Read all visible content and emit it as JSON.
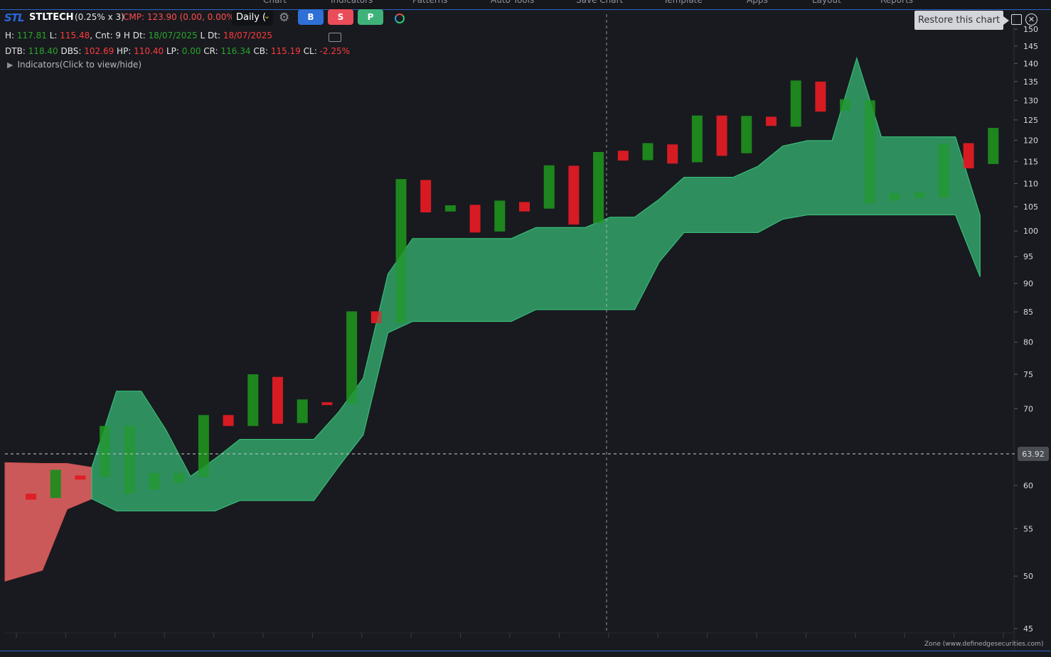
{
  "menu": {
    "items": [
      "Chart",
      "Indicators",
      "Patterns",
      "Auto Tools",
      "Save Chart",
      "Template",
      "Apps",
      "Layout",
      "Reports"
    ]
  },
  "toolbar": {
    "logo": "STL",
    "symbol": "STLTECH",
    "box_info": "(0.25% x 3)",
    "cmp": "CMP: 123.90 (0.00, 0.00%)",
    "timeframe": "Daily (",
    "buy_label": "B",
    "sell_label": "S",
    "p_label": "P"
  },
  "stats": {
    "row1": [
      {
        "label": "H: ",
        "value": "117.81",
        "color": "g"
      },
      {
        "label": " L: ",
        "value": "115.48",
        "color": "r"
      },
      {
        "label": ", Cnt: 9 H Dt: ",
        "value": "18/07/2025",
        "color": "g"
      },
      {
        "label": " L Dt: ",
        "value": "18/07/2025",
        "color": "r"
      }
    ],
    "row2": [
      {
        "label": "DTB: ",
        "value": "118.40",
        "color": "g"
      },
      {
        "label": " DBS: ",
        "value": "102.69",
        "color": "r"
      },
      {
        "label": " HP: ",
        "value": "110.40",
        "color": "r"
      },
      {
        "label": " LP: ",
        "value": "0.00",
        "color": "g"
      },
      {
        "label": " CR: ",
        "value": "116.34",
        "color": "g"
      },
      {
        "label": " CB: ",
        "value": "115.19",
        "color": "r"
      },
      {
        "label": " CL: ",
        "value": "-2.25%",
        "color": "r"
      }
    ]
  },
  "indicators_label": "Indicators(Click to view/hide)",
  "tooltip": "Restore this chart",
  "credit": "Zone (www.definedgesecurities.com)",
  "crosshair_price": "63.92",
  "colors": {
    "up": "#1e8c1e",
    "down": "#e01b24",
    "cloud_green": "#34a86e",
    "cloud_red": "#e06060"
  },
  "chart_data": {
    "type": "candlestick",
    "scale": "log",
    "ylim": [
      45,
      150
    ],
    "yticks": [
      45,
      50,
      55,
      60,
      65,
      70,
      75,
      80,
      85,
      90,
      95,
      100,
      105,
      110,
      115,
      120,
      125,
      130,
      135,
      140,
      145,
      150
    ],
    "crosshair_y": 63.92,
    "bars": [
      {
        "dir": "down",
        "open": 59.0,
        "close": 58.3
      },
      {
        "dir": "up",
        "open": 58.5,
        "close": 61.9
      },
      {
        "dir": "down",
        "open": 61.2,
        "close": 60.7
      },
      {
        "dir": "up",
        "open": 61.0,
        "close": 67.6
      },
      {
        "dir": "up",
        "open": 59.0,
        "close": 67.6
      },
      {
        "dir": "up",
        "open": 59.5,
        "close": 61.5
      },
      {
        "dir": "up",
        "open": 60.3,
        "close": 61.5
      },
      {
        "dir": "up",
        "open": 61.0,
        "close": 69.1
      },
      {
        "dir": "down",
        "open": 69.1,
        "close": 67.6
      },
      {
        "dir": "up",
        "open": 67.6,
        "close": 75.0
      },
      {
        "dir": "down",
        "open": 74.6,
        "close": 67.9
      },
      {
        "dir": "up",
        "open": 68.0,
        "close": 71.3
      },
      {
        "dir": "down",
        "open": 70.9,
        "close": 70.5
      },
      {
        "dir": "up",
        "open": 70.7,
        "close": 85.1
      },
      {
        "dir": "down",
        "open": 85.1,
        "close": 83.1
      },
      {
        "dir": "up",
        "open": 83.1,
        "close": 111.0
      },
      {
        "dir": "down",
        "open": 110.8,
        "close": 103.8
      },
      {
        "dir": "up",
        "open": 104.0,
        "close": 105.3
      },
      {
        "dir": "down",
        "open": 105.4,
        "close": 99.7
      },
      {
        "dir": "up",
        "open": 99.9,
        "close": 106.3
      },
      {
        "dir": "down",
        "open": 106.0,
        "close": 104.0
      },
      {
        "dir": "up",
        "open": 104.6,
        "close": 114.1
      },
      {
        "dir": "down",
        "open": 114.0,
        "close": 101.3
      },
      {
        "dir": "up",
        "open": 101.6,
        "close": 117.2
      },
      {
        "dir": "down",
        "open": 117.5,
        "close": 115.2
      },
      {
        "dir": "up",
        "open": 115.3,
        "close": 119.3
      },
      {
        "dir": "down",
        "open": 119.0,
        "close": 114.5
      },
      {
        "dir": "up",
        "open": 114.8,
        "close": 126.1
      },
      {
        "dir": "down",
        "open": 126.1,
        "close": 116.3
      },
      {
        "dir": "up",
        "open": 116.9,
        "close": 126.0
      },
      {
        "dir": "down",
        "open": 125.8,
        "close": 123.5
      },
      {
        "dir": "up",
        "open": 123.3,
        "close": 135.3
      },
      {
        "dir": "down",
        "open": 135.0,
        "close": 127.1
      },
      {
        "dir": "up",
        "open": 127.3,
        "close": 130.3
      },
      {
        "dir": "up",
        "open": 105.7,
        "close": 130.0
      },
      {
        "dir": "up",
        "open": 106.3,
        "close": 107.9
      },
      {
        "dir": "up",
        "open": 106.8,
        "close": 108.1
      },
      {
        "dir": "up",
        "open": 106.9,
        "close": 119.2
      },
      {
        "dir": "down",
        "open": 119.3,
        "close": 113.4
      },
      {
        "dir": "up",
        "open": 114.4,
        "close": 123.0
      }
    ],
    "cloud_upper": [
      62.8,
      62.7,
      62.7,
      62.2,
      72.5,
      72.5,
      67.1,
      61.1,
      63.3,
      65.8,
      65.8,
      65.8,
      65.8,
      69.5,
      74.4,
      91.7,
      98.5,
      98.5,
      98.5,
      98.5,
      98.5,
      100.7,
      100.7,
      100.7,
      102.8,
      102.8,
      106.6,
      111.4,
      111.4,
      111.4,
      113.9,
      118.6,
      119.9,
      119.9,
      141.5,
      120.8,
      120.8,
      120.8,
      120.8,
      103.2
    ],
    "cloud_lower": [
      49.5,
      50.6,
      57.2,
      58.4,
      57.0,
      57.0,
      57.0,
      57.0,
      57.0,
      58.2,
      58.2,
      58.2,
      58.2,
      62.3,
      66.4,
      81.5,
      83.4,
      83.4,
      83.4,
      83.4,
      83.4,
      85.4,
      85.4,
      85.4,
      85.4,
      85.4,
      94.0,
      99.7,
      99.7,
      99.7,
      99.7,
      102.4,
      103.3,
      103.3,
      103.3,
      103.3,
      103.3,
      103.3,
      103.3,
      91.2
    ],
    "cloud_red_until_index": 3
  }
}
